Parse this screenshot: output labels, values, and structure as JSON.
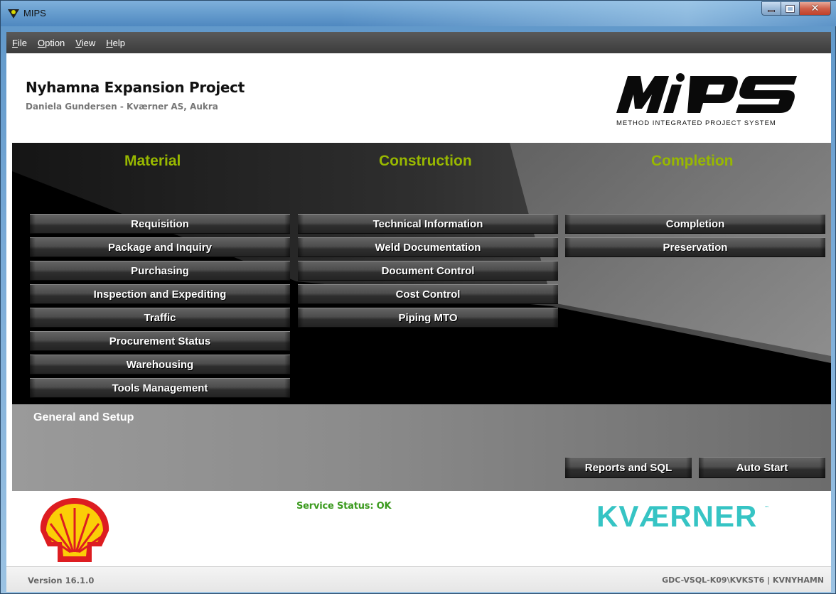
{
  "window": {
    "title": "MIPS"
  },
  "menu": [
    {
      "label": "File",
      "key": "F",
      "rest": "ile"
    },
    {
      "label": "Option",
      "key": "O",
      "rest": "ption"
    },
    {
      "label": "View",
      "key": "V",
      "rest": "iew"
    },
    {
      "label": "Help",
      "key": "H",
      "rest": "elp"
    }
  ],
  "header": {
    "project_title": "Nyhamna Expansion Project",
    "user_line": "Daniela Gundersen - Kværner AS, Aukra",
    "logo_text": "MiPS",
    "logo_tagline": "METHOD INTEGRATED PROJECT SYSTEM"
  },
  "columns": {
    "material": {
      "title": "Material",
      "items": [
        "Requisition",
        "Package and Inquiry",
        "Purchasing",
        "Inspection and Expediting",
        "Traffic",
        "Procurement Status",
        "Warehousing",
        "Tools Management"
      ]
    },
    "construction": {
      "title": "Construction",
      "items": [
        "Technical Information",
        "Weld Documentation",
        "Document Control",
        "Cost Control",
        "Piping MTO"
      ]
    },
    "completion": {
      "title": "Completion",
      "items": [
        "Completion",
        "Preservation"
      ]
    }
  },
  "setup": {
    "title": "General and Setup",
    "reports_label": "Reports and SQL",
    "autostart_label": "Auto Start"
  },
  "footer": {
    "service_status": "Service Status: OK",
    "kvaerner_logo": "KVÆRNER",
    "version": "Version 16.1.0",
    "server": "GDC-VSQL-K09\\KVKST6 | KVNYHAMN"
  },
  "colors": {
    "accent_green": "#98b800",
    "status_green": "#3b9a1e",
    "kvaerner_teal": "#36c4c4"
  }
}
